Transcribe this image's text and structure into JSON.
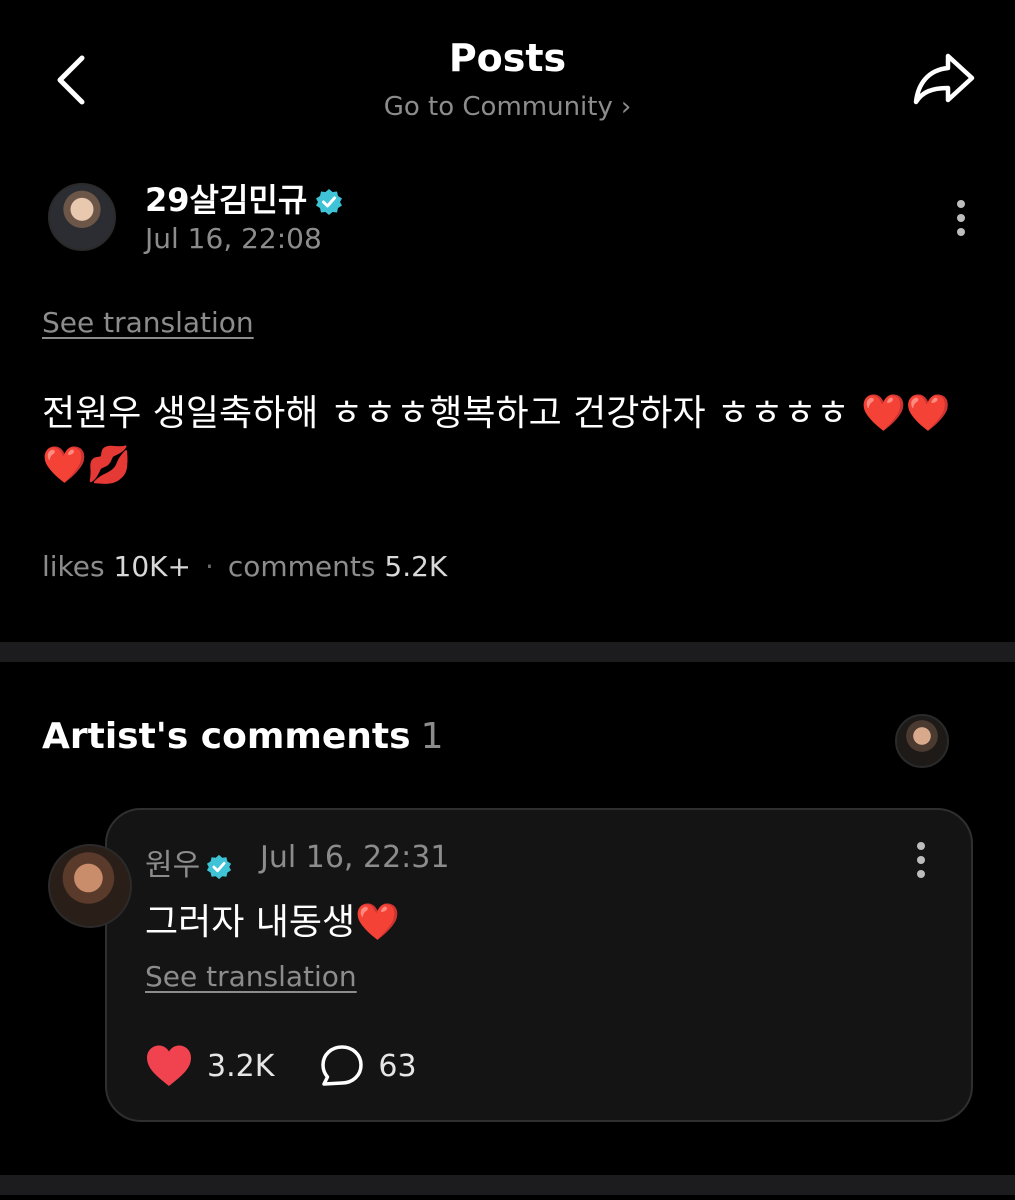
{
  "header": {
    "title": "Posts",
    "subtitle": "Go to Community",
    "subtitle_chevron": "›"
  },
  "post": {
    "author": "29살김민규",
    "date": "Jul 16, 22:08",
    "see_translation": "See translation",
    "body": "전원우 생일축하해 ㅎㅎㅎ행복하고 건강하자 ㅎㅎㅎㅎ ❤️❤️❤️💋",
    "likes_label": "likes",
    "likes_value": "10K+",
    "comments_label": "comments",
    "comments_value": "5.2K",
    "separator": "·"
  },
  "artist_comments": {
    "title": "Artist's comments",
    "count": "1",
    "comment": {
      "author": "원우",
      "date": "Jul 16, 22:31",
      "text": "그러자 내동생❤️",
      "see_translation": "See translation",
      "likes": "3.2K",
      "replies": "63"
    }
  },
  "colors": {
    "background": "#000000",
    "muted_text": "#8c8c8c",
    "verified": "#3ec4d6",
    "heart": "#f0434f",
    "card_bg": "#141414",
    "divider": "#1c1c1e"
  },
  "icons": [
    "back-chevron-icon",
    "share-arrow-icon",
    "verified-badge-icon",
    "more-vertical-icon",
    "heart-icon",
    "comment-bubble-icon"
  ]
}
